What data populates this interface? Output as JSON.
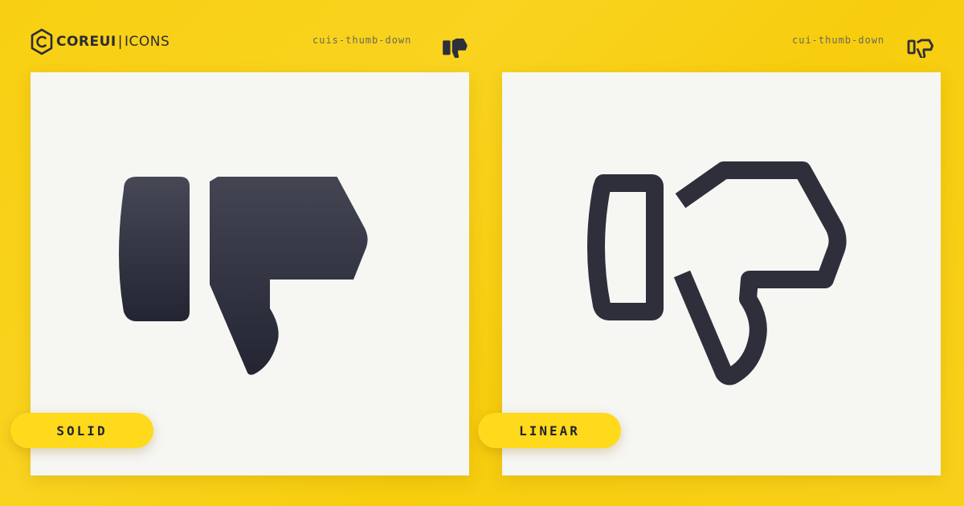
{
  "brand": {
    "bold": "COREUI",
    "separator": "|",
    "light": "ICONS",
    "logo_icon": "coreui-hexagon-logo"
  },
  "variants": [
    {
      "icon_name": "cuis-thumb-down",
      "style_label": "SOLID",
      "icon": "thumb-down-solid-icon"
    },
    {
      "icon_name": "cui-thumb-down",
      "style_label": "LINEAR",
      "icon": "thumb-down-linear-icon"
    }
  ],
  "colors": {
    "background": "#f8cf12",
    "panel": "#f6f6f3",
    "icon": "#2e2f3a",
    "pill": "#ffd91c",
    "label_text": "#22232c"
  }
}
